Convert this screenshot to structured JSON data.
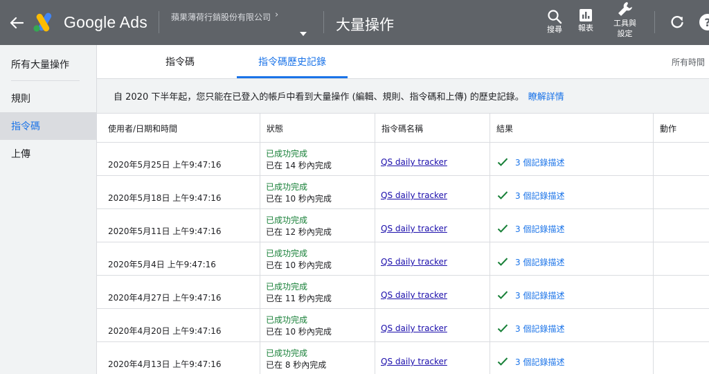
{
  "header": {
    "brand": "Google Ads",
    "account_name": "蘋果薄荷行銷股份有限公司",
    "page_title": "大量操作",
    "tools": {
      "search_label": "搜尋",
      "reports_label": "報表",
      "tools_label_line1": "工具與",
      "tools_label_line2": "設定"
    },
    "help_label": "?"
  },
  "sidebar": {
    "items": [
      {
        "label": "所有大量操作"
      },
      {
        "label": "規則"
      },
      {
        "label": "指令碼"
      },
      {
        "label": "上傳"
      }
    ],
    "active": "指令碼"
  },
  "tabs": {
    "items": [
      {
        "label": "指令碼"
      },
      {
        "label": "指令碼歷史記錄"
      }
    ],
    "active": "指令碼歷史記錄",
    "time_filter": "所有時間"
  },
  "notice": {
    "text": "自 2020 下半年起，您只能在已登入的帳戶中看到大量操作 (編輯、規則、指令碼和上傳) 的歷史記錄。",
    "link": "瞭解詳情"
  },
  "table": {
    "headers": [
      "使用者/日期和時間",
      "狀態",
      "指令碼名稱",
      "結果",
      "動作"
    ],
    "rows": [
      {
        "datetime": "2020年5月25日 上午9:47:16",
        "status": "已成功完成",
        "duration": "已在 14 秒內完成",
        "script": "QS daily tracker",
        "result": "3 個記錄描述"
      },
      {
        "datetime": "2020年5月18日 上午9:47:16",
        "status": "已成功完成",
        "duration": "已在 10 秒內完成",
        "script": "QS daily tracker",
        "result": "3 個記錄描述"
      },
      {
        "datetime": "2020年5月11日 上午9:47:16",
        "status": "已成功完成",
        "duration": "已在 12 秒內完成",
        "script": "QS daily tracker",
        "result": "3 個記錄描述"
      },
      {
        "datetime": "2020年5月4日 上午9:47:16",
        "status": "已成功完成",
        "duration": "已在 10 秒內完成",
        "script": "QS daily tracker",
        "result": "3 個記錄描述"
      },
      {
        "datetime": "2020年4月27日 上午9:47:16",
        "status": "已成功完成",
        "duration": "已在 11 秒內完成",
        "script": "QS daily tracker",
        "result": "3 個記錄描述"
      },
      {
        "datetime": "2020年4月20日 上午9:47:16",
        "status": "已成功完成",
        "duration": "已在 10 秒內完成",
        "script": "QS daily tracker",
        "result": "3 個記錄描述"
      },
      {
        "datetime": "2020年4月13日 上午9:47:16",
        "status": "已成功完成",
        "duration": "已在 8 秒內完成",
        "script": "QS daily tracker",
        "result": "3 個記錄描述"
      }
    ]
  },
  "colors": {
    "header_bg": "#5f6368",
    "accent": "#1a73e8",
    "success": "#188038",
    "sidebar_bg": "#f1f3f4"
  },
  "icons": [
    "back-arrow-icon",
    "google-ads-logo-icon",
    "chevron-right-icon",
    "dropdown-caret-icon",
    "search-icon",
    "reports-icon",
    "wrench-icon",
    "refresh-icon",
    "help-icon",
    "checkmark-icon"
  ]
}
